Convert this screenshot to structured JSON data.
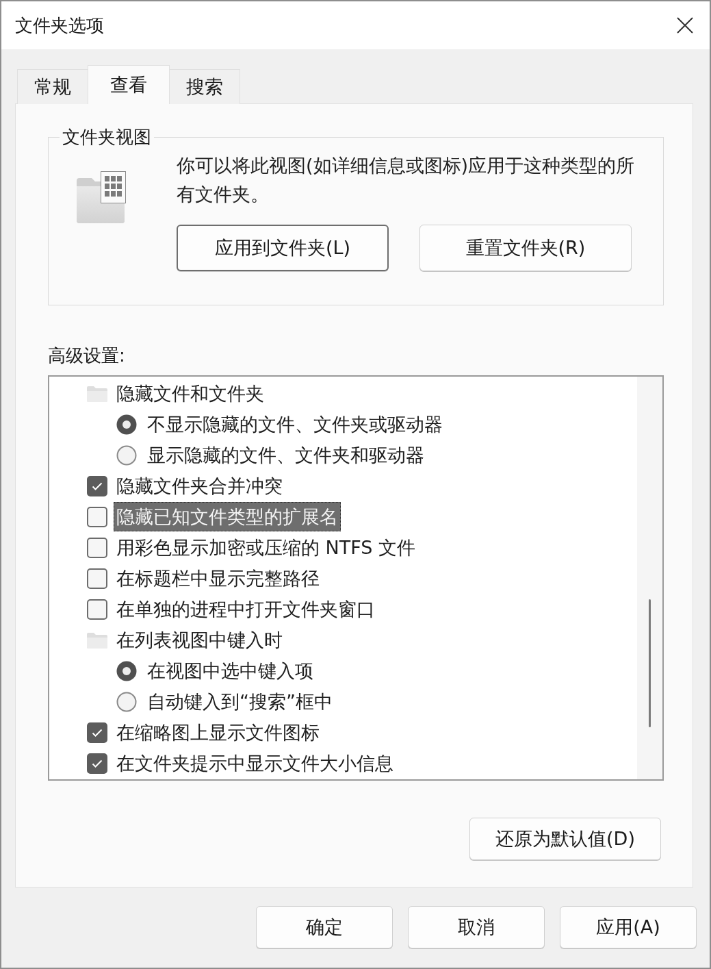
{
  "window": {
    "title": "文件夹选项"
  },
  "tabs": [
    {
      "label": "常规",
      "selected": false
    },
    {
      "label": "查看",
      "selected": true
    },
    {
      "label": "搜索",
      "selected": false
    }
  ],
  "folder_views": {
    "title": "文件夹视图",
    "description": "你可以将此视图(如详细信息或图标)应用于这种类型的所有文件夹。",
    "buttons": [
      {
        "label": "应用到文件夹(L)",
        "default": true
      },
      {
        "label": "重置文件夹(R)",
        "default": false
      }
    ]
  },
  "advanced": {
    "label": "高级设置:",
    "items": [
      {
        "kind": "group",
        "label": "隐藏文件和文件夹",
        "selected": false,
        "children": [
          {
            "kind": "radio",
            "label": "不显示隐藏的文件、文件夹或驱动器",
            "checked": true,
            "selected": false
          },
          {
            "kind": "radio",
            "label": "显示隐藏的文件、文件夹和驱动器",
            "checked": false,
            "selected": false
          }
        ]
      },
      {
        "kind": "checkbox",
        "label": "隐藏文件夹合并冲突",
        "checked": true,
        "selected": false
      },
      {
        "kind": "checkbox",
        "label": "隐藏已知文件类型的扩展名",
        "checked": false,
        "selected": true
      },
      {
        "kind": "checkbox",
        "label": "用彩色显示加密或压缩的 NTFS 文件",
        "checked": false,
        "selected": false
      },
      {
        "kind": "checkbox",
        "label": "在标题栏中显示完整路径",
        "checked": false,
        "selected": false
      },
      {
        "kind": "checkbox",
        "label": "在单独的进程中打开文件夹窗口",
        "checked": false,
        "selected": false
      },
      {
        "kind": "group",
        "label": "在列表视图中键入时",
        "selected": false,
        "children": [
          {
            "kind": "radio",
            "label": "在视图中选中键入项",
            "checked": true,
            "selected": false
          },
          {
            "kind": "radio",
            "label": "自动键入到“搜索”框中",
            "checked": false,
            "selected": false
          }
        ]
      },
      {
        "kind": "checkbox",
        "label": "在缩略图上显示文件图标",
        "checked": true,
        "selected": false
      },
      {
        "kind": "checkbox",
        "label": "在文件夹提示中显示文件大小信息",
        "checked": true,
        "selected": false
      }
    ],
    "reset_button": "还原为默认值(D)"
  },
  "dialog_buttons": [
    "确定",
    "取消",
    "应用(A)"
  ]
}
